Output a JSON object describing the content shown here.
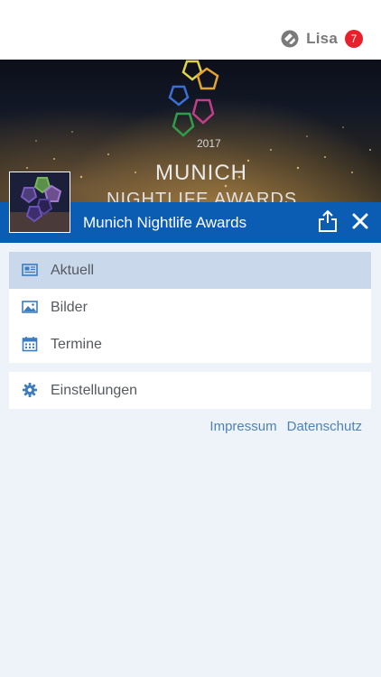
{
  "header": {
    "user_name": "Lisa",
    "notification_count": "7"
  },
  "hero": {
    "year": "2017",
    "title_line1": "MUNICH",
    "title_line2": "NIGHTLIFE AWARDS"
  },
  "titlebar": {
    "title": "Munich Nightlife Awards"
  },
  "menu": {
    "items": [
      {
        "label": "Aktuell",
        "icon": "newspaper-icon",
        "active": true
      },
      {
        "label": "Bilder",
        "icon": "image-icon",
        "active": false
      },
      {
        "label": "Termine",
        "icon": "calendar-icon",
        "active": false
      }
    ],
    "settings": {
      "label": "Einstellungen",
      "icon": "gear-icon"
    }
  },
  "footer": {
    "impressum": "Impressum",
    "datenschutz": "Datenschutz"
  },
  "colors": {
    "accent": "#0a5db3",
    "badge": "#e8202a",
    "link": "#4d84b4",
    "active_item": "#c9d8ea"
  }
}
